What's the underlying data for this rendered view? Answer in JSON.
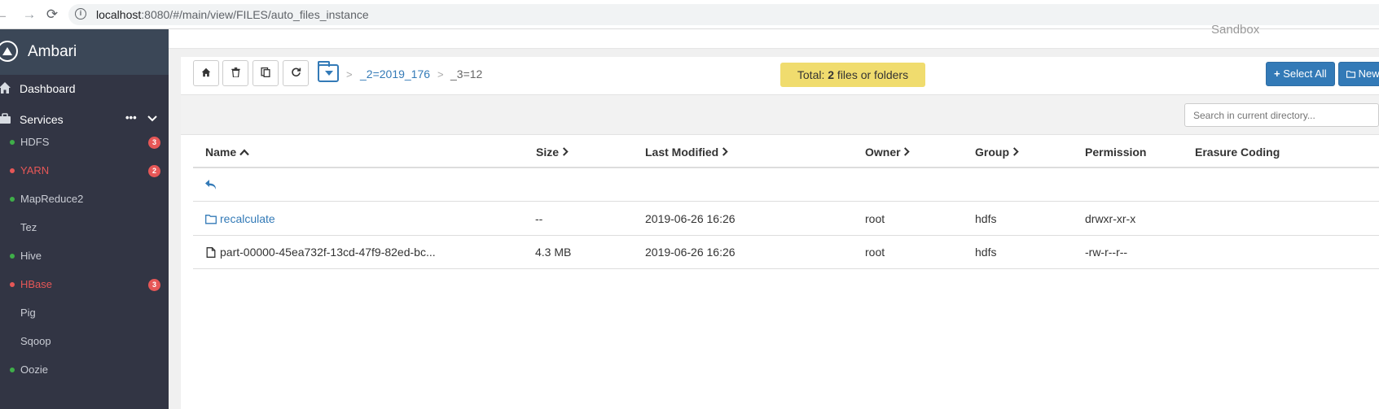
{
  "browser": {
    "url_host": "localhost",
    "url_path": ":8080/#/main/view/FILES/auto_files_instance"
  },
  "sidebar": {
    "brand": "Ambari",
    "dashboard_label": "Dashboard",
    "services_label": "Services",
    "services_menu_glyph": "•••",
    "services": [
      {
        "name": "HDFS",
        "status": "ok",
        "alerts": "3"
      },
      {
        "name": "YARN",
        "status": "alert",
        "alerts": "2"
      },
      {
        "name": "MapReduce2",
        "status": "ok",
        "alerts": ""
      },
      {
        "name": "Tez",
        "status": "none",
        "alerts": ""
      },
      {
        "name": "Hive",
        "status": "ok",
        "alerts": ""
      },
      {
        "name": "HBase",
        "status": "alert",
        "alerts": "3"
      },
      {
        "name": "Pig",
        "status": "none",
        "alerts": ""
      },
      {
        "name": "Sqoop",
        "status": "none",
        "alerts": ""
      },
      {
        "name": "Oozie",
        "status": "ok",
        "alerts": ""
      }
    ]
  },
  "header": {
    "sandbox_label": "Sandbox"
  },
  "toolbar": {
    "breadcrumb_sep": ">",
    "breadcrumb_link": "_2=2019_176",
    "breadcrumb_current": "_3=12",
    "total_prefix": "Total: ",
    "total_count": "2",
    "total_suffix": " files or folders",
    "select_all_label": "Select All",
    "new_label": "New"
  },
  "search": {
    "placeholder": "Search in current directory..."
  },
  "table": {
    "headers": {
      "name": "Name",
      "size": "Size",
      "modified": "Last Modified",
      "owner": "Owner",
      "group": "Group",
      "permission": "Permission",
      "erasure": "Erasure Coding"
    },
    "rows": [
      {
        "name": "recalculate",
        "type": "folder",
        "size": "--",
        "modified": "2019-06-26 16:26",
        "owner": "root",
        "group": "hdfs",
        "permission": "drwxr-xr-x"
      },
      {
        "name": "part-00000-45ea732f-13cd-47f9-82ed-bc...",
        "type": "file",
        "size": "4.3 MB",
        "modified": "2019-06-26 16:26",
        "owner": "root",
        "group": "hdfs",
        "permission": "-rw-r--r--"
      }
    ]
  },
  "colors": {
    "sidebar_bg": "#323544",
    "accent": "#337ab7",
    "badge_alert": "#e65757",
    "ok_dot": "#3fae49",
    "total_badge_bg": "#f0dc6e"
  }
}
